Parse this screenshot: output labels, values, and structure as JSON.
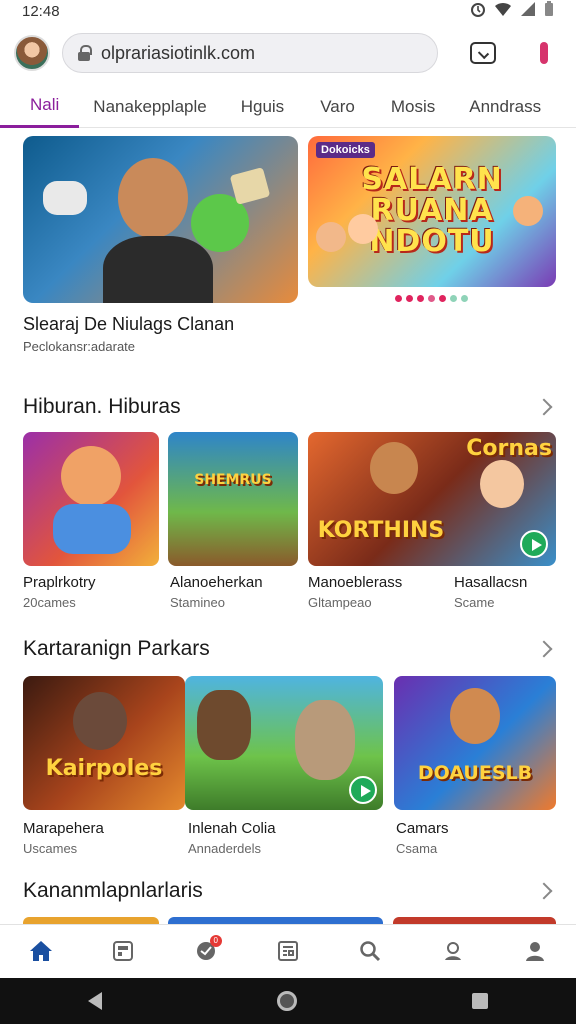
{
  "status_bar": {
    "time": "12:48"
  },
  "browser": {
    "url": "olprariasiotinlk.com"
  },
  "tabs": [
    {
      "label": "Nali",
      "active": true
    },
    {
      "label": "Nanakepplaple"
    },
    {
      "label": "Hguis"
    },
    {
      "label": "Varo"
    },
    {
      "label": "Mosis"
    },
    {
      "label": "Anndrass"
    }
  ],
  "hero": {
    "right_tag": "Dokoicks",
    "right_title": "SALARN RUANA NDOTU",
    "title": "Slearaj De Niulags Clanan",
    "subtitle": "Peclokansr:adarate",
    "dot_colors": [
      "#e0245e",
      "#e0245e",
      "#e0245e",
      "#e05a8a",
      "#e0245e",
      "#8fd3b8",
      "#8fd3b8"
    ]
  },
  "sections": [
    {
      "title": "Hiburan. Hiburas",
      "cards": [
        {
          "title": "Praplrkotry",
          "subtitle": "20cames",
          "art_text": ""
        },
        {
          "title": "Alanoeherkan",
          "subtitle": "Stamineo",
          "art_text": "SHEMRUS"
        },
        {
          "title": "Manoeblerass",
          "subtitle": "Gltampeao",
          "art_text": "KORTHINS"
        },
        {
          "title": "Hasallacsn",
          "subtitle": "Scame",
          "art_text": "Cornas"
        }
      ]
    },
    {
      "title": "Kartaranign Parkars",
      "cards": [
        {
          "title": "Marapehera",
          "subtitle": "Uscames",
          "art_text": "Kairpoles"
        },
        {
          "title": "Inlenah Colia",
          "subtitle": "Annaderdels",
          "art_text": ""
        },
        {
          "title": "Camars",
          "subtitle": "Csama",
          "art_text": "DOAUESLB"
        }
      ]
    },
    {
      "title": "Kananmlapnlarlaris"
    }
  ],
  "bottom_nav": [
    {
      "icon": "home-icon",
      "active": true
    },
    {
      "icon": "games-icon"
    },
    {
      "icon": "notifications-icon",
      "badge": "0"
    },
    {
      "icon": "news-icon"
    },
    {
      "icon": "search-icon"
    },
    {
      "icon": "location-icon"
    },
    {
      "icon": "profile-icon"
    }
  ],
  "colors": {
    "accent": "#8b1e9c",
    "nav_active": "#1a4fa0"
  }
}
